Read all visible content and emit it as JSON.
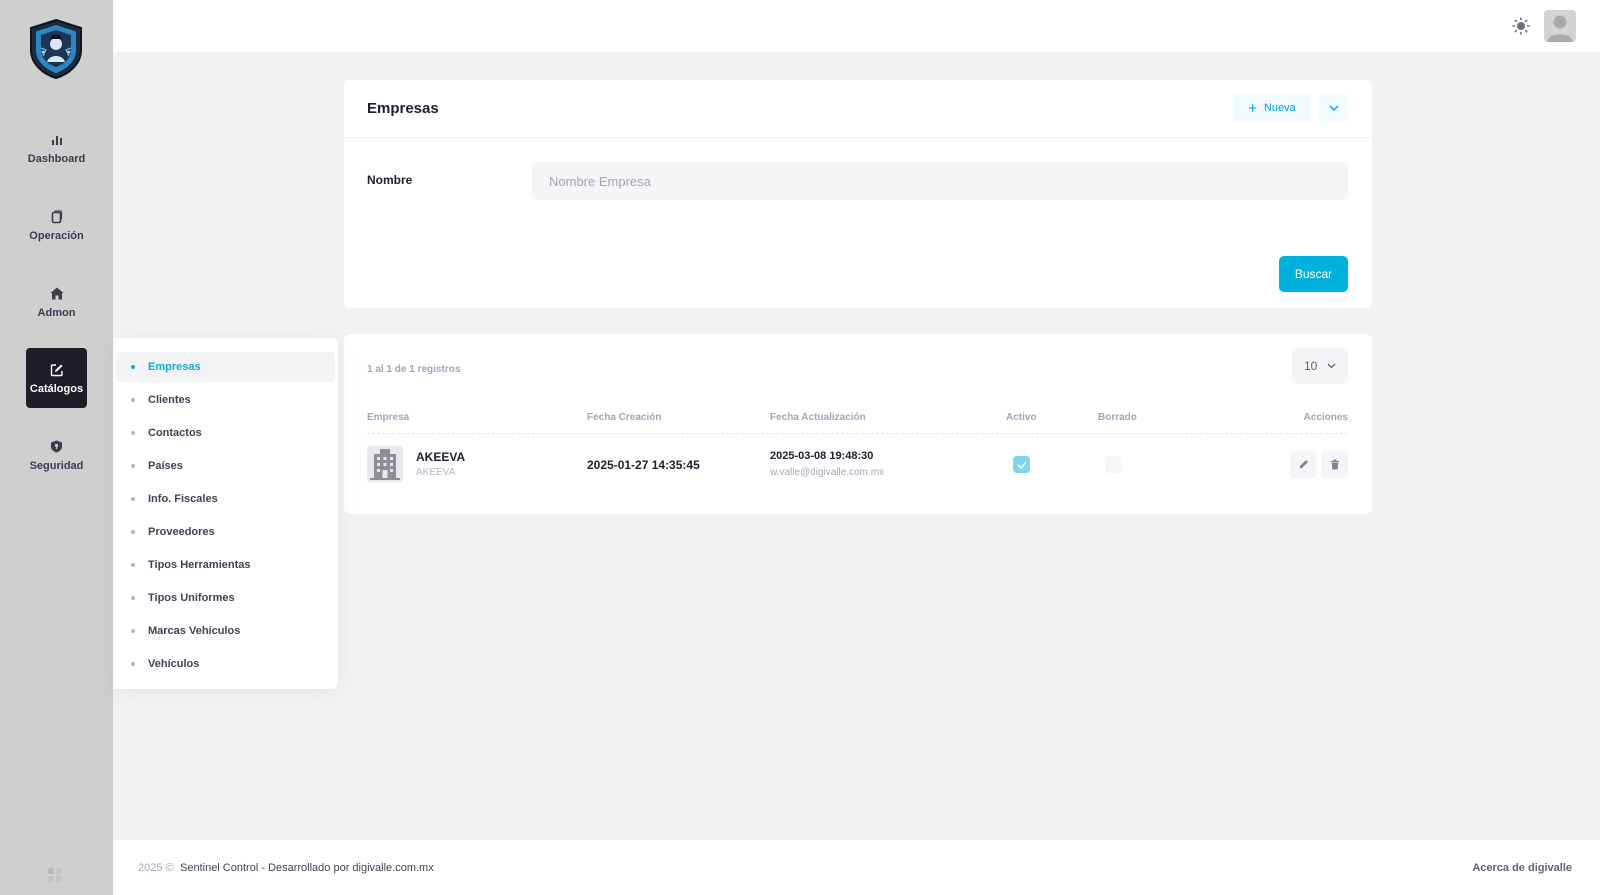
{
  "sidebar": {
    "items": [
      {
        "label": "Dashboard",
        "icon": "bar-chart-icon"
      },
      {
        "label": "Operación",
        "icon": "copy-icon"
      },
      {
        "label": "Admon",
        "icon": "home-icon"
      },
      {
        "label": "Catálogos",
        "icon": "edit-icon",
        "active": true
      },
      {
        "label": "Seguridad",
        "icon": "shield-icon"
      }
    ]
  },
  "submenu": {
    "items": [
      {
        "label": "Empresas",
        "active": true
      },
      {
        "label": "Clientes"
      },
      {
        "label": "Contactos"
      },
      {
        "label": "Países"
      },
      {
        "label": "Info. Fiscales"
      },
      {
        "label": "Proveedores"
      },
      {
        "label": "Tipos Herramientas"
      },
      {
        "label": "Tipos Uniformes"
      },
      {
        "label": "Marcas Vehículos"
      },
      {
        "label": "Vehículos"
      }
    ]
  },
  "search_card": {
    "title": "Empresas",
    "new_button": "Nueva",
    "field_label": "Nombre",
    "field_placeholder": "Nombre Empresa",
    "field_value": "",
    "search_button": "Buscar"
  },
  "results": {
    "records_info": "1 al 1 de 1 registros",
    "page_size": "10",
    "columns": [
      "Empresa",
      "Fecha Creación",
      "Fecha Actualización",
      "Activo",
      "Borrado",
      "Acciones"
    ],
    "rows": [
      {
        "name": "AKEEVA",
        "short_name": "AKEEVA",
        "created": "2025-01-27 14:35:45",
        "updated": "2025-03-08 19:48:30",
        "updated_by": "w.valle@digivalle.com.mx",
        "active": true,
        "deleted": false
      }
    ]
  },
  "footer": {
    "year": "2025 ©",
    "text": "Sentinel Control - Desarrollado por digivalle.com.mx",
    "link": "Acerca de digivalle"
  },
  "colors": {
    "accent": "#00b2db",
    "sidebar_bg": "#cfcfcf",
    "active_nav_bg": "#1d1e27"
  }
}
